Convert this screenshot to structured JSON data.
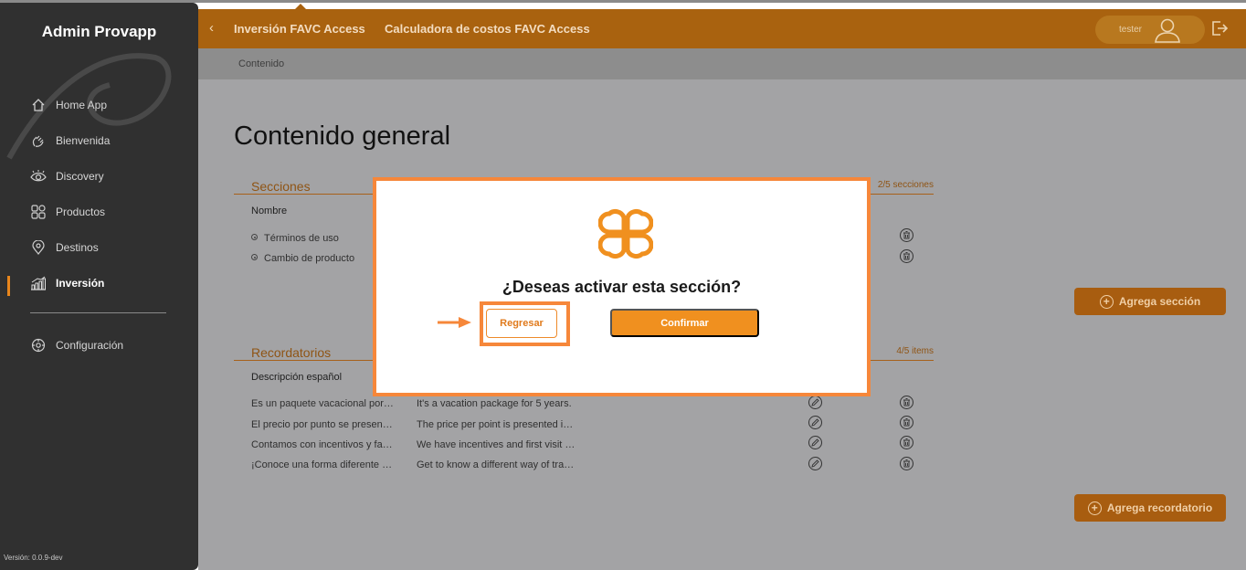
{
  "app": {
    "brand": "Admin Provapp",
    "version": "Versión: 0.0.9-dev"
  },
  "sidebar": {
    "items": [
      {
        "label": "Home App",
        "icon": "home-icon"
      },
      {
        "label": "Bienvenida",
        "icon": "hand-wave-icon"
      },
      {
        "label": "Discovery",
        "icon": "eye-icon"
      },
      {
        "label": "Productos",
        "icon": "grid-icon"
      },
      {
        "label": "Destinos",
        "icon": "location-pin-icon"
      },
      {
        "label": "Inversión",
        "icon": "bar-chart-icon",
        "active": true
      }
    ],
    "settings": {
      "label": "Configuración",
      "icon": "gear-icon"
    }
  },
  "topbar": {
    "crumb1": "Inversión FAVC Access",
    "crumb2": "Calculadora de costos FAVC Access",
    "user": "tester"
  },
  "subheader": {
    "label": "Contenido"
  },
  "main": {
    "title": "Contenido general",
    "secciones": {
      "label": "Secciones",
      "count": "2/5 secciones",
      "column": "Nombre",
      "rows": [
        "Términos de uso",
        "Cambio de producto"
      ],
      "add_label": "Agrega sección"
    },
    "recordatorios": {
      "label": "Recordatorios",
      "count": "4/5 items",
      "column": "Descripción español",
      "rows": [
        {
          "es": "Es un paquete vacacional por…",
          "en": "It's a vacation package for 5 years."
        },
        {
          "es": "El precio por punto se presen…",
          "en": "The price per point is presented i…"
        },
        {
          "es": "Contamos con incentivos y fa…",
          "en": "We have incentives and first visit …"
        },
        {
          "es": "¡Conoce una forma diferente …",
          "en": "Get to know a different way of tra…"
        }
      ],
      "add_label": "Agrega recordatorio"
    }
  },
  "modal": {
    "question": "¿Deseas activar esta sección?",
    "back_label": "Regresar",
    "confirm_label": "Confirmar"
  },
  "colors": {
    "accent": "#f0901f",
    "highlight": "#f6873a",
    "sidebar": "#303030"
  }
}
